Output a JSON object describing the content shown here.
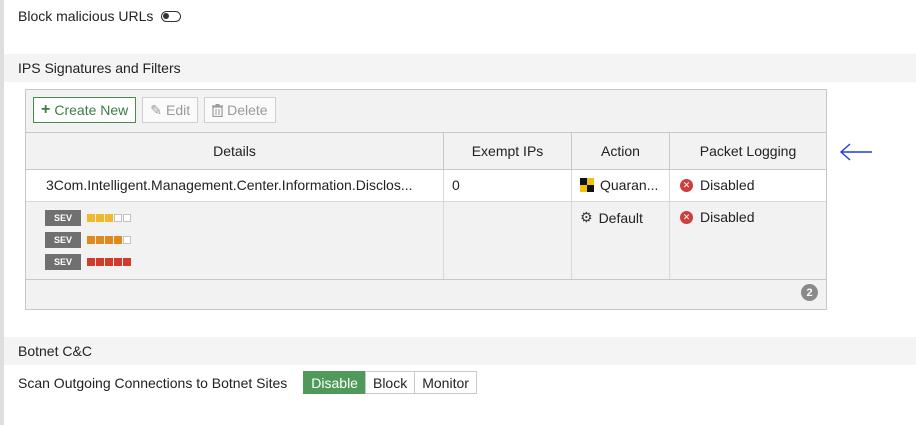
{
  "top": {
    "block_urls_label": "Block malicious URLs",
    "block_urls_enabled": false
  },
  "ips": {
    "section_title": "IPS Signatures and Filters",
    "toolbar": {
      "create_new": "Create New",
      "edit": "Edit",
      "delete": "Delete"
    },
    "columns": [
      "Details",
      "Exempt IPs",
      "Action",
      "Packet Logging"
    ],
    "rows": [
      {
        "details": "3Com.Intelligent.Management.Center.Information.Disclos...",
        "exempt_ips": "0",
        "action": "Quaran...",
        "action_icon": "quarantine-icon",
        "logging": "Disabled"
      },
      {
        "details_sev": [
          {
            "label": "SEV",
            "filled": 3,
            "total": 5,
            "color": "#f0b92c"
          },
          {
            "label": "SEV",
            "filled": 4,
            "total": 5,
            "color": "#e08a1e"
          },
          {
            "label": "SEV",
            "filled": 5,
            "total": 5,
            "color": "#d23a2c"
          }
        ],
        "exempt_ips": "",
        "action": "Default",
        "action_icon": "gear-icon",
        "logging": "Disabled"
      }
    ],
    "count_badge": "2"
  },
  "botnet": {
    "section_title": "Botnet C&C",
    "scan_label": "Scan Outgoing Connections to Botnet Sites",
    "options": [
      "Disable",
      "Block",
      "Monitor"
    ],
    "selected": "Disable"
  },
  "colors": {
    "accent_green": "#4f9a5b",
    "arrow_blue": "#1f3ed6",
    "disabled_red": "#d23c3c"
  }
}
